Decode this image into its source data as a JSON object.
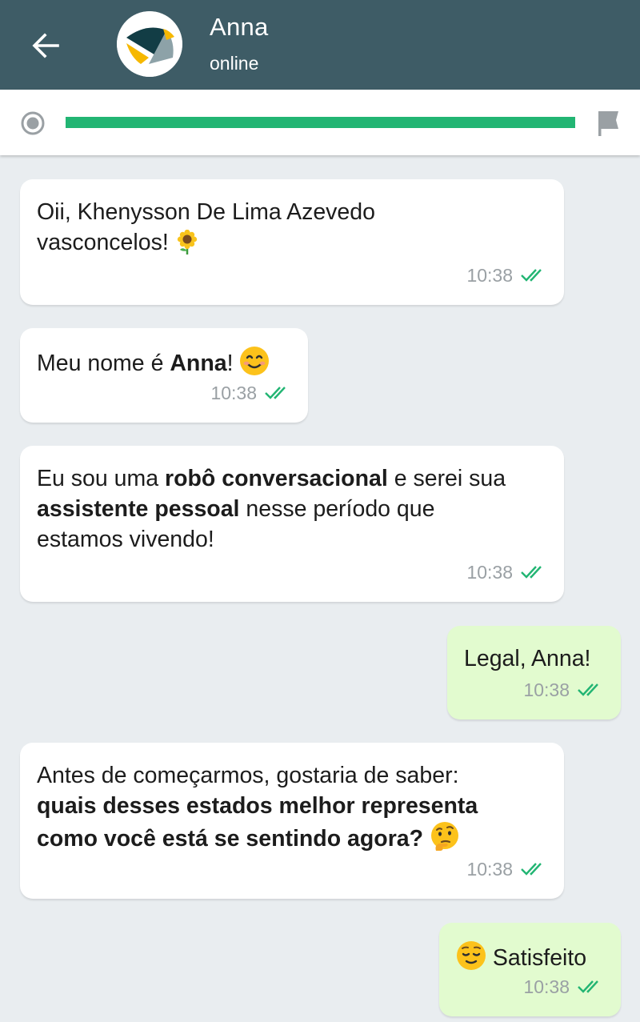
{
  "header": {
    "contact_name": "Anna",
    "contact_status": "online",
    "back_icon": "arrow-left-icon",
    "avatar_icon": "anna-logo"
  },
  "progress": {
    "value": 1.0,
    "start_icon": "radio-dot-icon",
    "end_icon": "flag-icon"
  },
  "colors": {
    "header_bg": "#3e5c66",
    "progress": "#22b573",
    "chat_bg": "#e9edf0",
    "incoming_bubble": "#ffffff",
    "outgoing_bubble": "#e2fbcf",
    "read_ticks": "#22b573"
  },
  "messages": [
    {
      "direction": "incoming",
      "line1": "Oii, Khenysson De Lima Azevedo",
      "line2": "vasconcelos!",
      "emoji": "sunflower",
      "time": "10:38",
      "status": "read"
    },
    {
      "direction": "incoming",
      "prefix": "Meu nome é ",
      "bold": "Anna",
      "suffix": "!",
      "emoji": "smiling-face",
      "time": "10:38",
      "status": "read"
    },
    {
      "direction": "incoming",
      "part1": "Eu sou uma ",
      "bold1": "robô conversacional",
      "part2": " e serei sua",
      "bold2": "assistente pessoal",
      "part3": " nesse período que",
      "line3": "estamos vivendo!",
      "time": "10:38",
      "status": "read"
    },
    {
      "direction": "outgoing",
      "text": "Legal, Anna!",
      "time": "10:38",
      "status": "read"
    },
    {
      "direction": "incoming",
      "line1": "Antes de começarmos, gostaria de saber:",
      "bold1": "quais desses estados melhor representa",
      "bold2": "como você está se sentindo agora?",
      "emoji": "thinking-face",
      "time": "10:38",
      "status": "read"
    },
    {
      "direction": "outgoing",
      "emoji": "relieved-face",
      "text": "Satisfeito",
      "time": "10:38",
      "status": "read"
    }
  ]
}
